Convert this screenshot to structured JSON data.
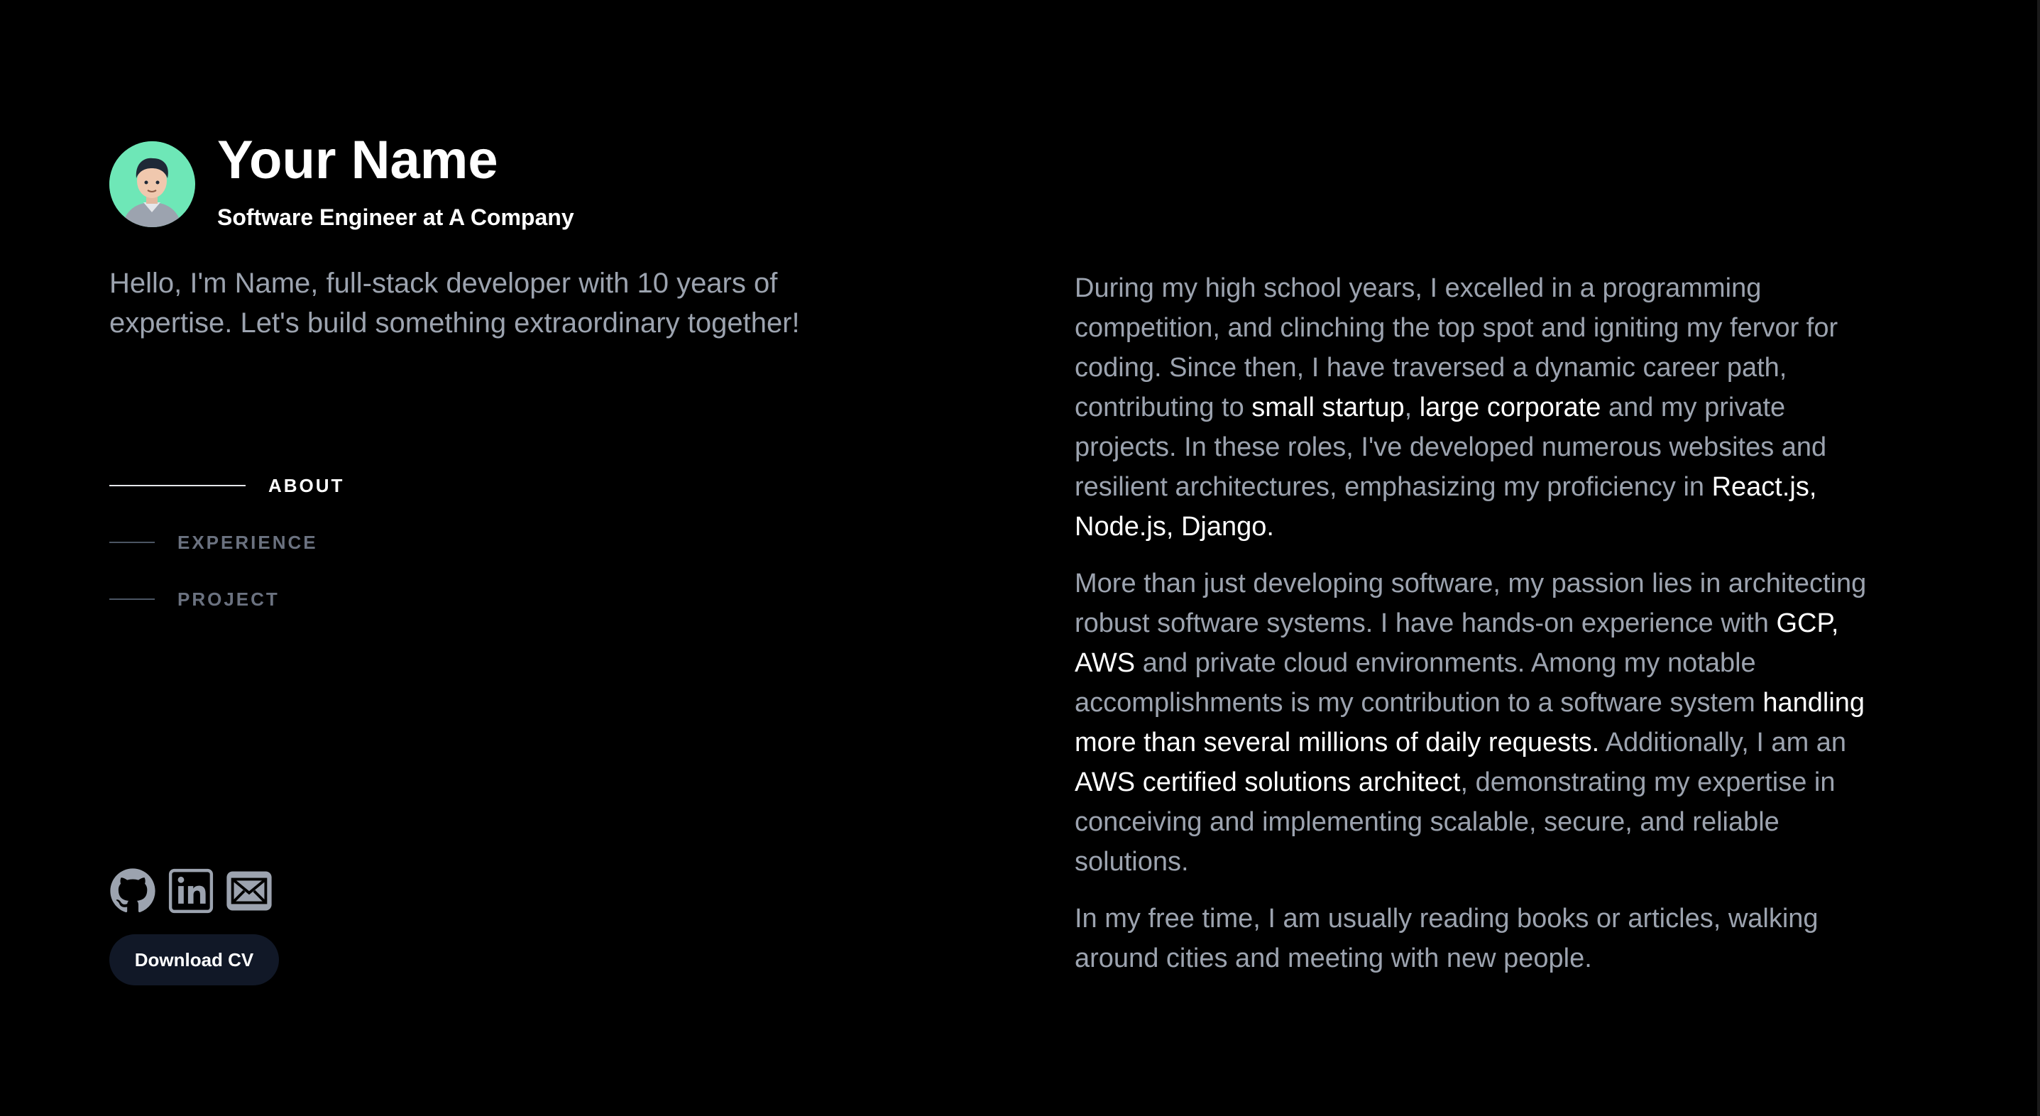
{
  "profile": {
    "name": "Your Name",
    "role": "Software Engineer at A Company",
    "tagline": "Hello, I'm Name, full-stack developer with 10 years of expertise. Let's build something extraordinary together!"
  },
  "nav": {
    "items": [
      {
        "label": "ABOUT",
        "active": true
      },
      {
        "label": "EXPERIENCE",
        "active": false
      },
      {
        "label": "PROJECT",
        "active": false
      }
    ]
  },
  "socials": {
    "icons": [
      "github-icon",
      "linkedin-icon",
      "email-icon"
    ]
  },
  "cv_button": {
    "label": "Download CV"
  },
  "about": {
    "p1": {
      "t1": "During my high school years, I excelled in a programming competition, and clinching the top spot and igniting my fervor for coding. Since then, I have traversed a dynamic career path, contributing to ",
      "h1": "small startup",
      "t2": ", ",
      "h2": "large corporate",
      "t3": " and my private projects. In these roles, I've developed numerous websites and resilient architectures, emphasizing my proficiency in ",
      "h3": "React.js, Node.js, Django."
    },
    "p2": {
      "t1": "More than just developing software, my passion lies in architecting robust software systems. I have hands-on experience with ",
      "h1": "GCP, AWS",
      "t2": " and private cloud environments. Among my notable accomplishments is my contribution to a software system ",
      "h2": "handling more than several millions of daily requests.",
      "t3": " Additionally, I am an ",
      "h3": "AWS certified solutions architect",
      "t4": ", demonstrating my expertise in conceiving and implementing scalable, secure, and reliable solutions."
    },
    "p3": {
      "t1": "In my free time, I am usually reading books or articles, walking around cities and meeting with new people."
    }
  },
  "colors": {
    "background": "#000000",
    "text_muted": "#9ca3af",
    "text_highlight": "#ffffff",
    "avatar_bg": "#6ee7b7",
    "button_bg": "#111827",
    "icon": "#9ca3af"
  }
}
